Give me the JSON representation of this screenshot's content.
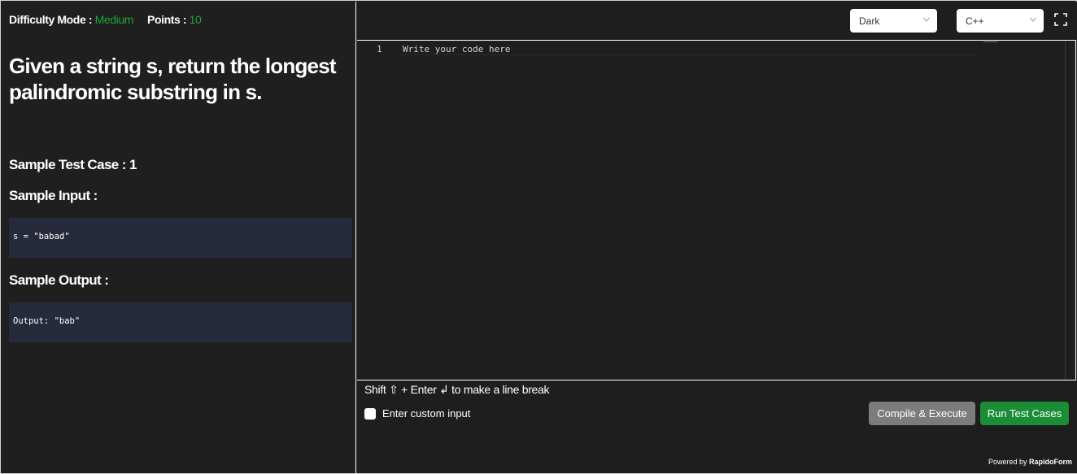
{
  "header": {
    "difficulty_label": "Difficulty Mode :",
    "difficulty_value": "Medium",
    "points_label": "Points :",
    "points_value": "10"
  },
  "question": "Given a string s, return the longest palindromic substring in s.",
  "sample": {
    "case_heading": "Sample Test Case : 1",
    "input_heading": "Sample Input :",
    "input_value": "s = \"babad\"",
    "output_heading": "Sample Output :",
    "output_value": "Output: \"bab\""
  },
  "toolbar": {
    "theme_selected": "Dark",
    "language_selected": "C++"
  },
  "editor": {
    "line_number": "1",
    "placeholder_line": "Write your code here"
  },
  "footer": {
    "hint": "Shift ⇧ + Enter ↲ to make a line break",
    "custom_input_label": "Enter custom input",
    "compile_label": "Compile & Execute",
    "run_label": "Run Test Cases",
    "powered_prefix": "Powered by",
    "powered_brand": "RapidoForm"
  },
  "colors": {
    "accent_green": "#1ea43a",
    "run_button": "#1a8d36",
    "compile_button": "#7c7c7c",
    "code_box": "#262a3b",
    "panel_bg": "#1f1f1f"
  }
}
